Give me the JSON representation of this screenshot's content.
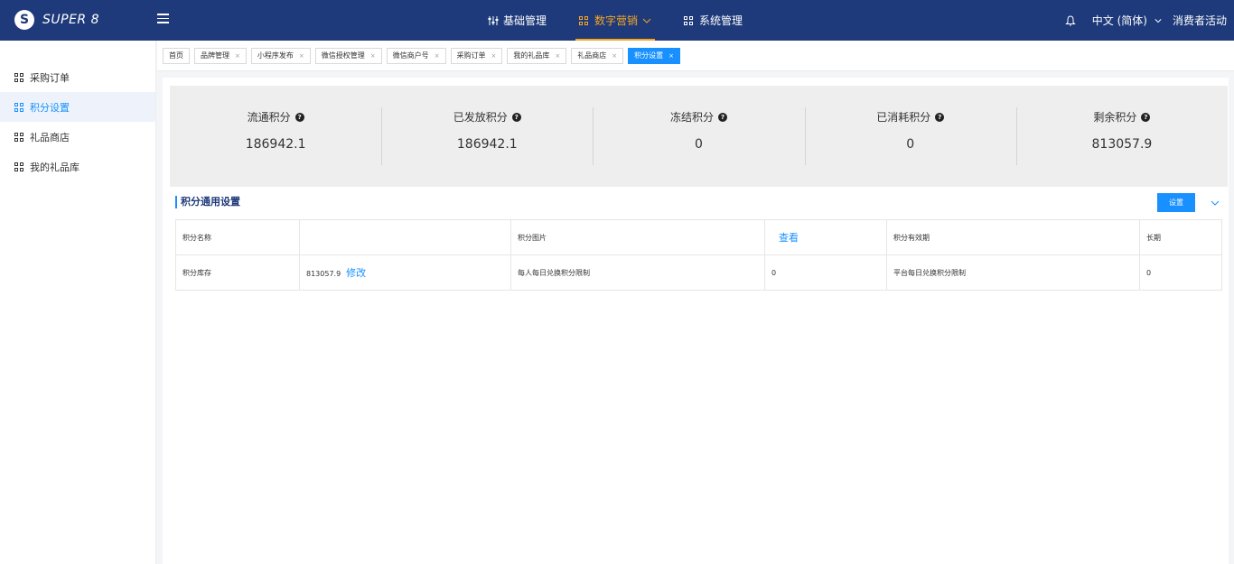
{
  "app": {
    "logo_mark": "S",
    "logo_text": "SUPER 8"
  },
  "nav": [
    {
      "label": "基础管理",
      "icon": "sliders-icon"
    },
    {
      "label": "数字营销",
      "icon": "grid-icon"
    },
    {
      "label": "系统管理",
      "icon": "grid-icon"
    }
  ],
  "header_right": {
    "language": "中文 (简体)",
    "user": "消费者活动"
  },
  "sidebar": {
    "items": [
      {
        "label": "采购订单"
      },
      {
        "label": "积分设置"
      },
      {
        "label": "礼品商店"
      },
      {
        "label": "我的礼品库"
      }
    ]
  },
  "tabs": [
    {
      "label": "首页"
    },
    {
      "label": "品牌管理"
    },
    {
      "label": "小程序发布"
    },
    {
      "label": "微信授权管理"
    },
    {
      "label": "微信商户号"
    },
    {
      "label": "采购订单"
    },
    {
      "label": "我的礼品库"
    },
    {
      "label": "礼品商店"
    },
    {
      "label": "积分设置"
    }
  ],
  "stats": [
    {
      "label": "流通积分",
      "value": "186942.1"
    },
    {
      "label": "已发放积分",
      "value": "186942.1"
    },
    {
      "label": "冻结积分",
      "value": "0"
    },
    {
      "label": "已消耗积分",
      "value": "0"
    },
    {
      "label": "剩余积分",
      "value": "813057.9"
    }
  ],
  "section": {
    "title": "积分通用设置",
    "set_button": "设置"
  },
  "table": {
    "row1": {
      "c1": "积分名称",
      "c2": "",
      "c3": "积分图片",
      "c4_link": "查看",
      "c5": "积分有效期",
      "c6": "长期"
    },
    "row2": {
      "c1": "积分库存",
      "c2_value": "813057.9",
      "c2_link": "修改",
      "c3": "每人每日兑换积分限制",
      "c4": "0",
      "c5": "平台每日兑换积分限制",
      "c6": "0"
    }
  },
  "colors": {
    "header_bg": "#1e3a7a",
    "accent": "#1890ff",
    "active_nav": "#f5a623"
  },
  "tab_close_glyph": "×",
  "help_glyph": "?"
}
